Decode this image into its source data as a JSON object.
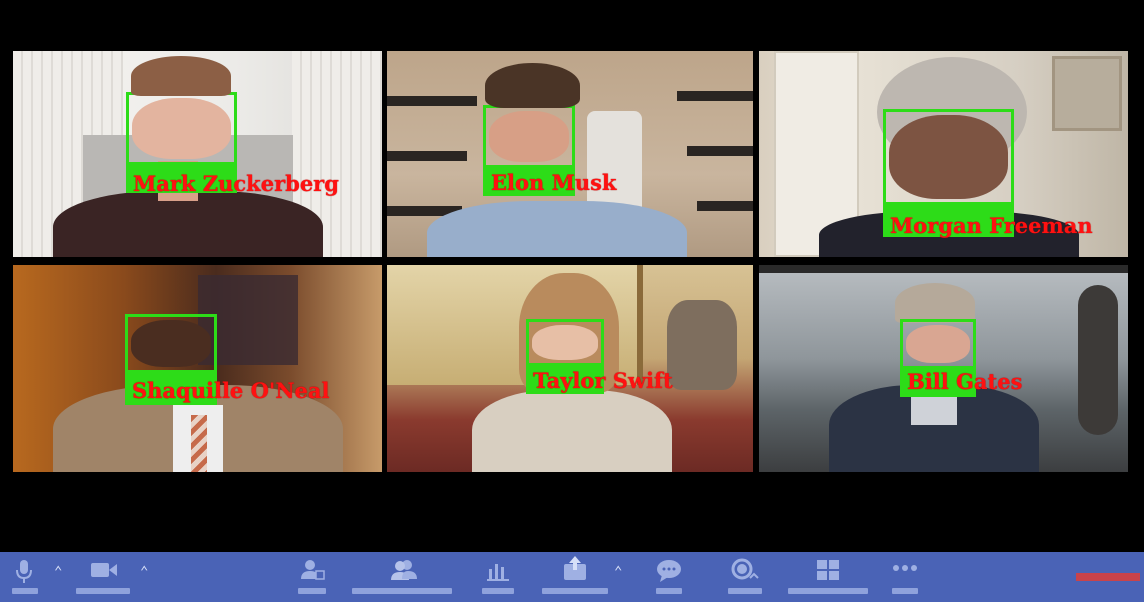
{
  "participants": [
    {
      "name": "Mark Zuckerberg"
    },
    {
      "name": "Elon Musk"
    },
    {
      "name": "Morgan Freeman"
    },
    {
      "name": "Shaquille O'Neal"
    },
    {
      "name": "Taylor Swift"
    },
    {
      "name": "Bill Gates"
    }
  ],
  "colors": {
    "face_box": "#2ddc18",
    "label_text": "#ff1111",
    "toolbar": "#4a63b6",
    "end_button": "#c8434b"
  },
  "toolbar": {
    "icons": [
      "microphone-icon",
      "video-camera-icon",
      "invite-icon",
      "participants-icon",
      "polls-icon",
      "share-screen-icon",
      "chat-icon",
      "record-icon",
      "breakout-rooms-icon",
      "more-icon"
    ]
  }
}
